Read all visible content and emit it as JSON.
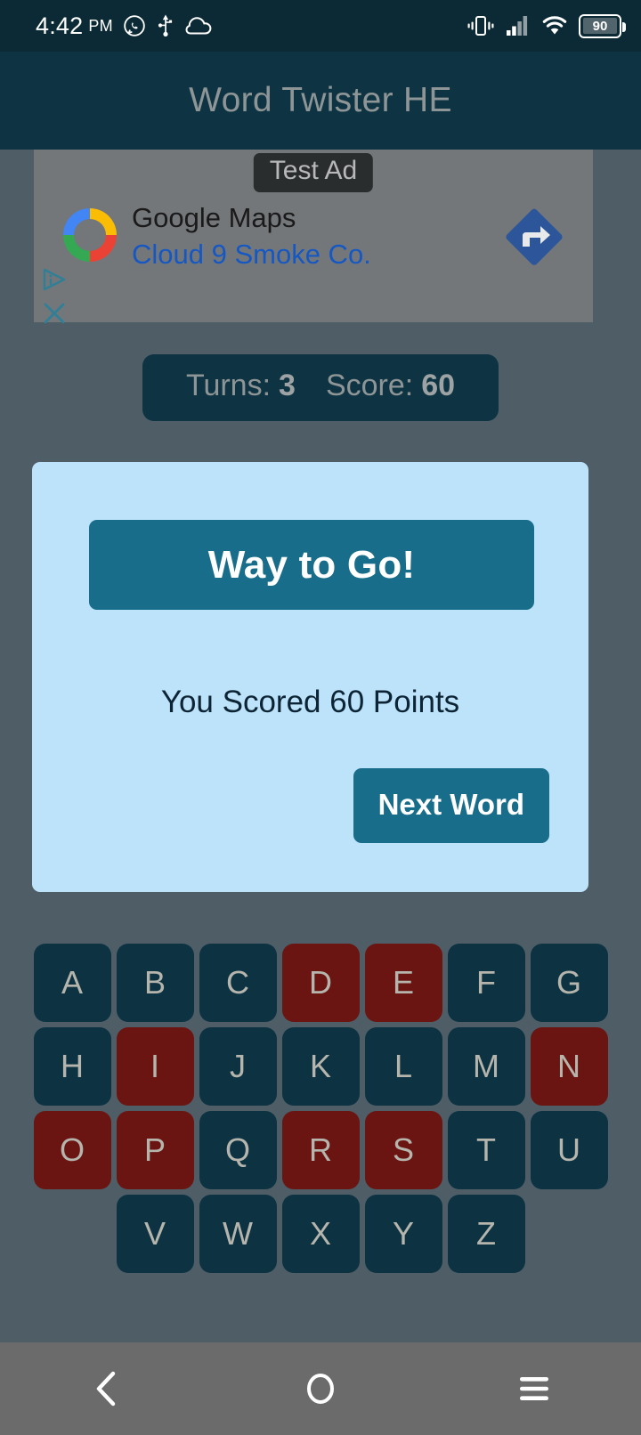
{
  "status_bar": {
    "time": "4:42",
    "ampm": "PM",
    "icons_left": [
      "whatsapp-icon",
      "usb-icon",
      "cloud-icon"
    ],
    "icons_right": [
      "vibrate-icon",
      "signal-icon",
      "wifi-icon",
      "battery-icon"
    ],
    "battery_level": "90",
    "background": "#0c2a36"
  },
  "app_bar": {
    "title": "Word Twister HE",
    "background": "#0e3342",
    "title_color": "#8e9596"
  },
  "ad": {
    "test_label": "Test Ad",
    "headline": "Google Maps",
    "advertiser": "Cloud 9 Smoke Co.",
    "logo_icon": "google-maps-ring-icon",
    "cta_icon": "navigation-arrow-icon",
    "adchoices_icon": "adchoices-icon",
    "close_icon": "close-icon",
    "advertiser_color": "#1558c4",
    "background": "#74777a"
  },
  "score_bar": {
    "turns_label": "Turns:",
    "turns_value": "3",
    "score_label": "Score:",
    "score_value": "60",
    "background": "#0e3342"
  },
  "dialog": {
    "title": "Way to Go!",
    "message": "You Scored 60 Points",
    "next_button_label": "Next Word",
    "card_background": "#bde3fb",
    "accent": "#186d8a"
  },
  "keyboard": {
    "teal_color": "#0d3343",
    "red_color": "#6b1512",
    "letter_color": "#b5b5ad",
    "rows": [
      [
        {
          "letter": "A",
          "state": "available"
        },
        {
          "letter": "B",
          "state": "available"
        },
        {
          "letter": "C",
          "state": "available"
        },
        {
          "letter": "D",
          "state": "used"
        },
        {
          "letter": "E",
          "state": "used"
        },
        {
          "letter": "F",
          "state": "available"
        },
        {
          "letter": "G",
          "state": "available"
        }
      ],
      [
        {
          "letter": "H",
          "state": "available"
        },
        {
          "letter": "I",
          "state": "used"
        },
        {
          "letter": "J",
          "state": "available"
        },
        {
          "letter": "K",
          "state": "available"
        },
        {
          "letter": "L",
          "state": "available"
        },
        {
          "letter": "M",
          "state": "available"
        },
        {
          "letter": "N",
          "state": "used"
        }
      ],
      [
        {
          "letter": "O",
          "state": "used"
        },
        {
          "letter": "P",
          "state": "used"
        },
        {
          "letter": "Q",
          "state": "available"
        },
        {
          "letter": "R",
          "state": "used"
        },
        {
          "letter": "S",
          "state": "used"
        },
        {
          "letter": "T",
          "state": "available"
        },
        {
          "letter": "U",
          "state": "available"
        }
      ],
      [
        {
          "letter": "V",
          "state": "available"
        },
        {
          "letter": "W",
          "state": "available"
        },
        {
          "letter": "X",
          "state": "available"
        },
        {
          "letter": "Y",
          "state": "available"
        },
        {
          "letter": "Z",
          "state": "available"
        }
      ]
    ]
  },
  "nav_bar": {
    "back_icon": "back-chevron-icon",
    "home_icon": "home-circle-icon",
    "recents_icon": "recents-menu-icon",
    "background": "#6b6b6b"
  },
  "page_background": "#4e5d66"
}
